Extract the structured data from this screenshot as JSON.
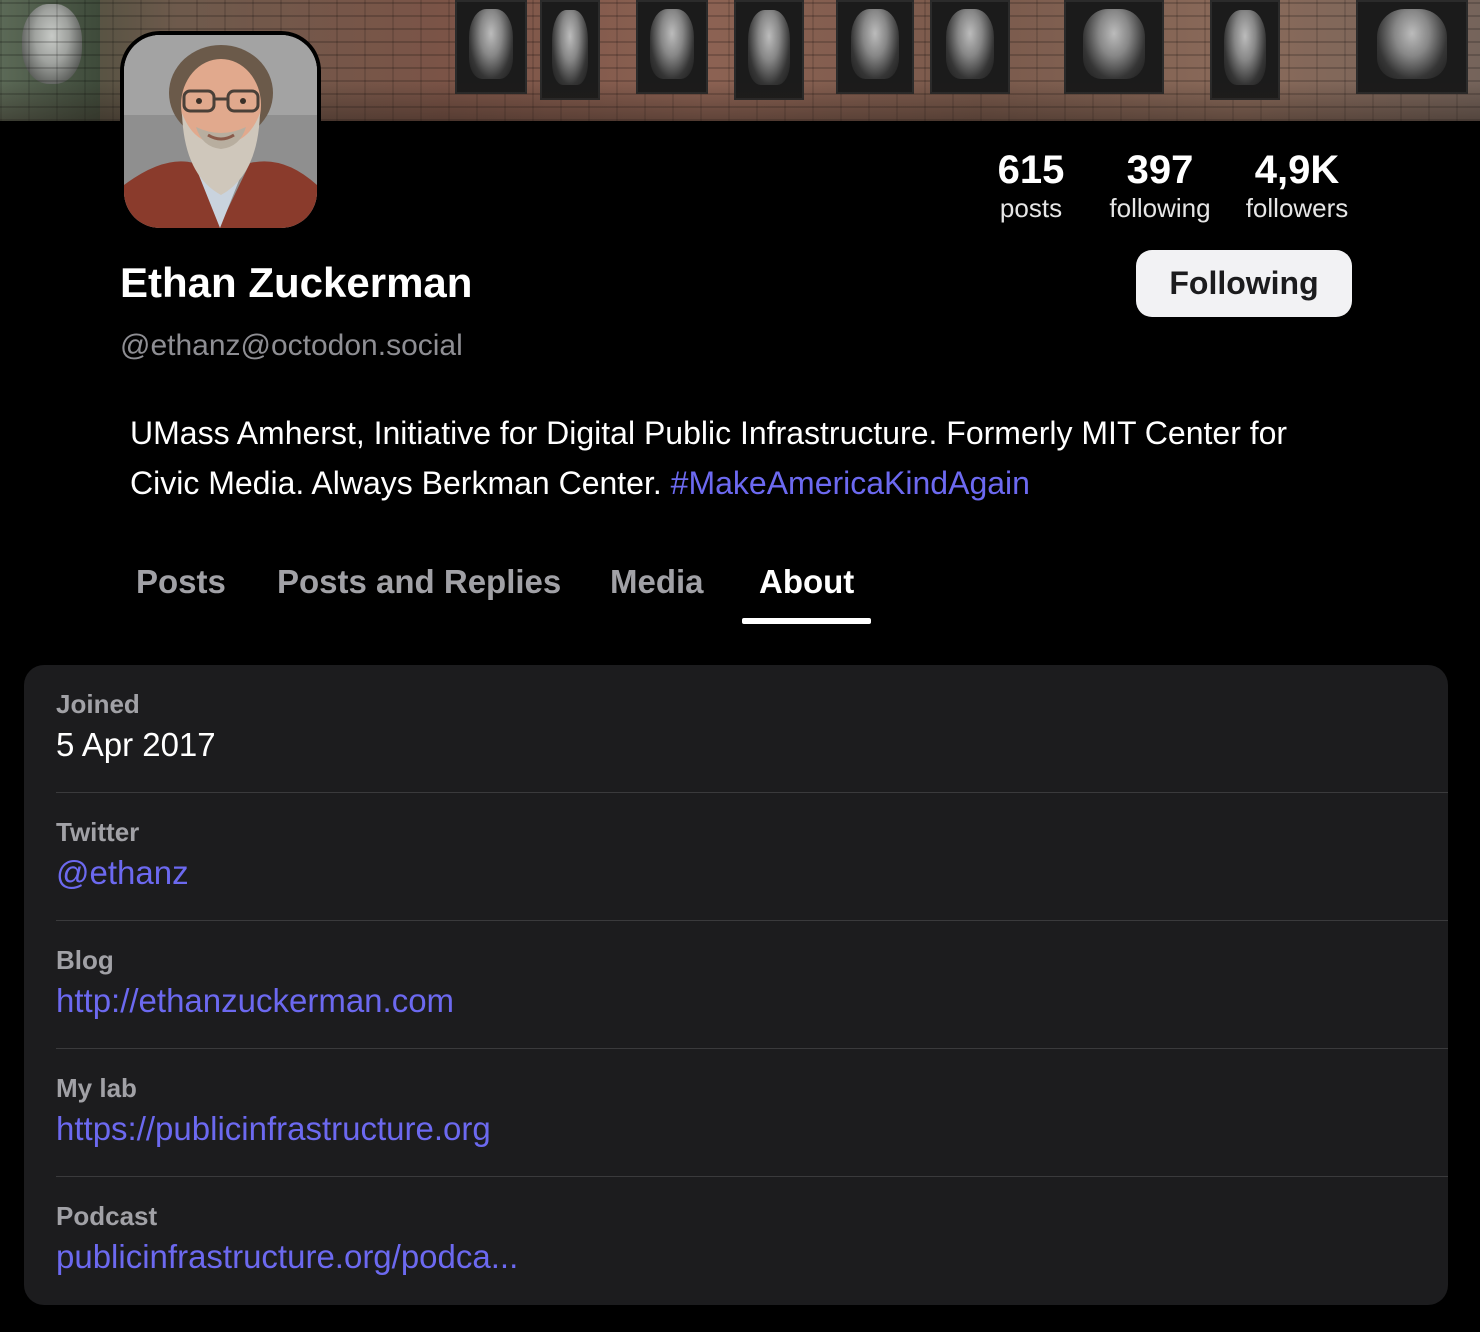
{
  "profile": {
    "display_name": "Ethan Zuckerman",
    "handle": "@ethanz@octodon.social",
    "follow_button_label": "Following"
  },
  "stats": {
    "posts": {
      "value": "615",
      "label": "posts"
    },
    "following": {
      "value": "397",
      "label": "following"
    },
    "followers": {
      "value": "4,9K",
      "label": "followers"
    }
  },
  "bio": {
    "text": "UMass Amherst, Initiative for Digital Public Infrastructure. Formerly MIT Center for Civic Media. Always Berkman Center. ",
    "hashtag": "#MakeAmericaKindAgain"
  },
  "tabs": [
    {
      "label": "Posts"
    },
    {
      "label": "Posts and Replies"
    },
    {
      "label": "Media"
    },
    {
      "label": "About"
    }
  ],
  "active_tab": "About",
  "about_fields": [
    {
      "label": "Joined",
      "value": "5 Apr 2017"
    },
    {
      "label": "Twitter",
      "value": "@ethanz"
    },
    {
      "label": "Blog",
      "value": "http://ethanzuckerman.com"
    },
    {
      "label": "My lab",
      "value": "https://publicinfrastructure.org"
    },
    {
      "label": "Podcast",
      "value": "publicinfrastructure.org/podca..."
    }
  ],
  "colors": {
    "background": "#000000",
    "card": "#1c1c1e",
    "accent_link": "#6c69f0",
    "secondary_text": "#8e8e93",
    "button_bg": "#f2f2f4"
  }
}
